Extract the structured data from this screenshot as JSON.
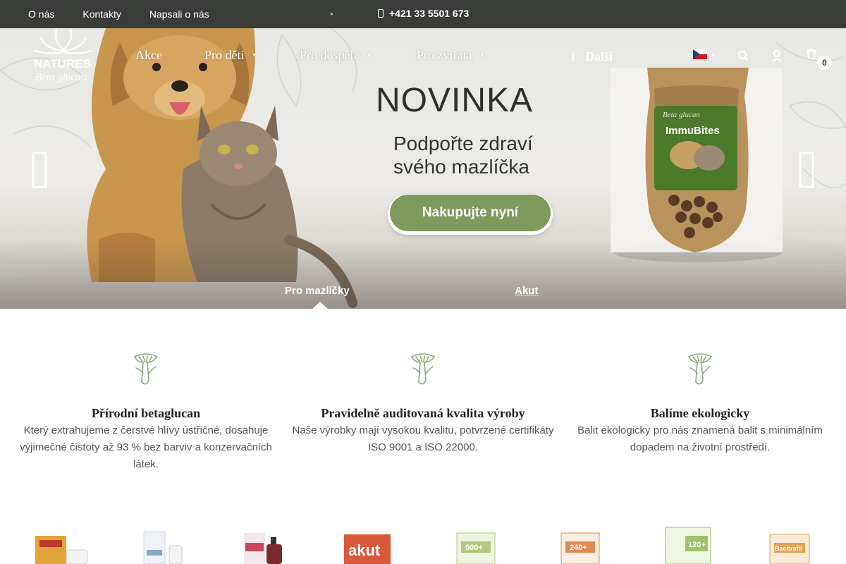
{
  "topbar": {
    "links": [
      "O nás",
      "Kontakty",
      "Napsali o nás"
    ],
    "phone": "+421 33 5501 673"
  },
  "header": {
    "logo": {
      "line1": "NATURES",
      "line2": "Beta glucan",
      "icon": "leaf-logo"
    },
    "nav": [
      "Akce",
      "Pro děti",
      "Pro dospělé",
      "Pro zvířata"
    ],
    "more_label": "Další",
    "language": "cs",
    "cart_count": "0",
    "icons": [
      "search-icon",
      "user-icon",
      "cart-icon"
    ]
  },
  "hero": {
    "headline": "NOVINKA",
    "subline": "Podpořte zdraví svého mazlíčka",
    "cta": "Nakupujte nyní",
    "product_label": "ImmuBites",
    "product_brand": "Beta glucan",
    "tabs": [
      "Pro mazlíčky",
      "Akut"
    ],
    "active_tab": 0,
    "colors": {
      "cta": "#7e9a5d",
      "bag": "#b9925c",
      "label": "#4b7a2a"
    }
  },
  "features": [
    {
      "title": "Přírodní betaglucan",
      "text": "Který extrahujeme z čerstvé hlívy ústřičné, dosahuje výjimečné čistoty až 93 % bez barviv a konzervačních látek.",
      "icon": "mushroom-icon"
    },
    {
      "title": "Pravidelně auditovaná kvalita výroby",
      "text": "Naše výrobky mají vysokou kvalitu, potvrzené certifikáty ISO 9001 a ISO 22000.",
      "icon": "mushroom-icon"
    },
    {
      "title": "Balíme ekologicky",
      "text": "Balit ekologicky pro nás znamená balit s minimálním dopadem na životní prostředí.",
      "icon": "mushroom-icon"
    }
  ],
  "products": [
    {
      "label": "",
      "color": "#e3a23a"
    },
    {
      "label": "",
      "color": "#dfe6ee"
    },
    {
      "label": "",
      "color": "#c44a5a"
    },
    {
      "label": "akut",
      "color": "#d8583a"
    },
    {
      "label": "500+",
      "color": "#b5c77a"
    },
    {
      "label": "240+",
      "color": "#e08a52"
    },
    {
      "label": "120+",
      "color": "#9dc26b"
    },
    {
      "label": "Bacitrafil",
      "color": "#e7a052"
    }
  ]
}
